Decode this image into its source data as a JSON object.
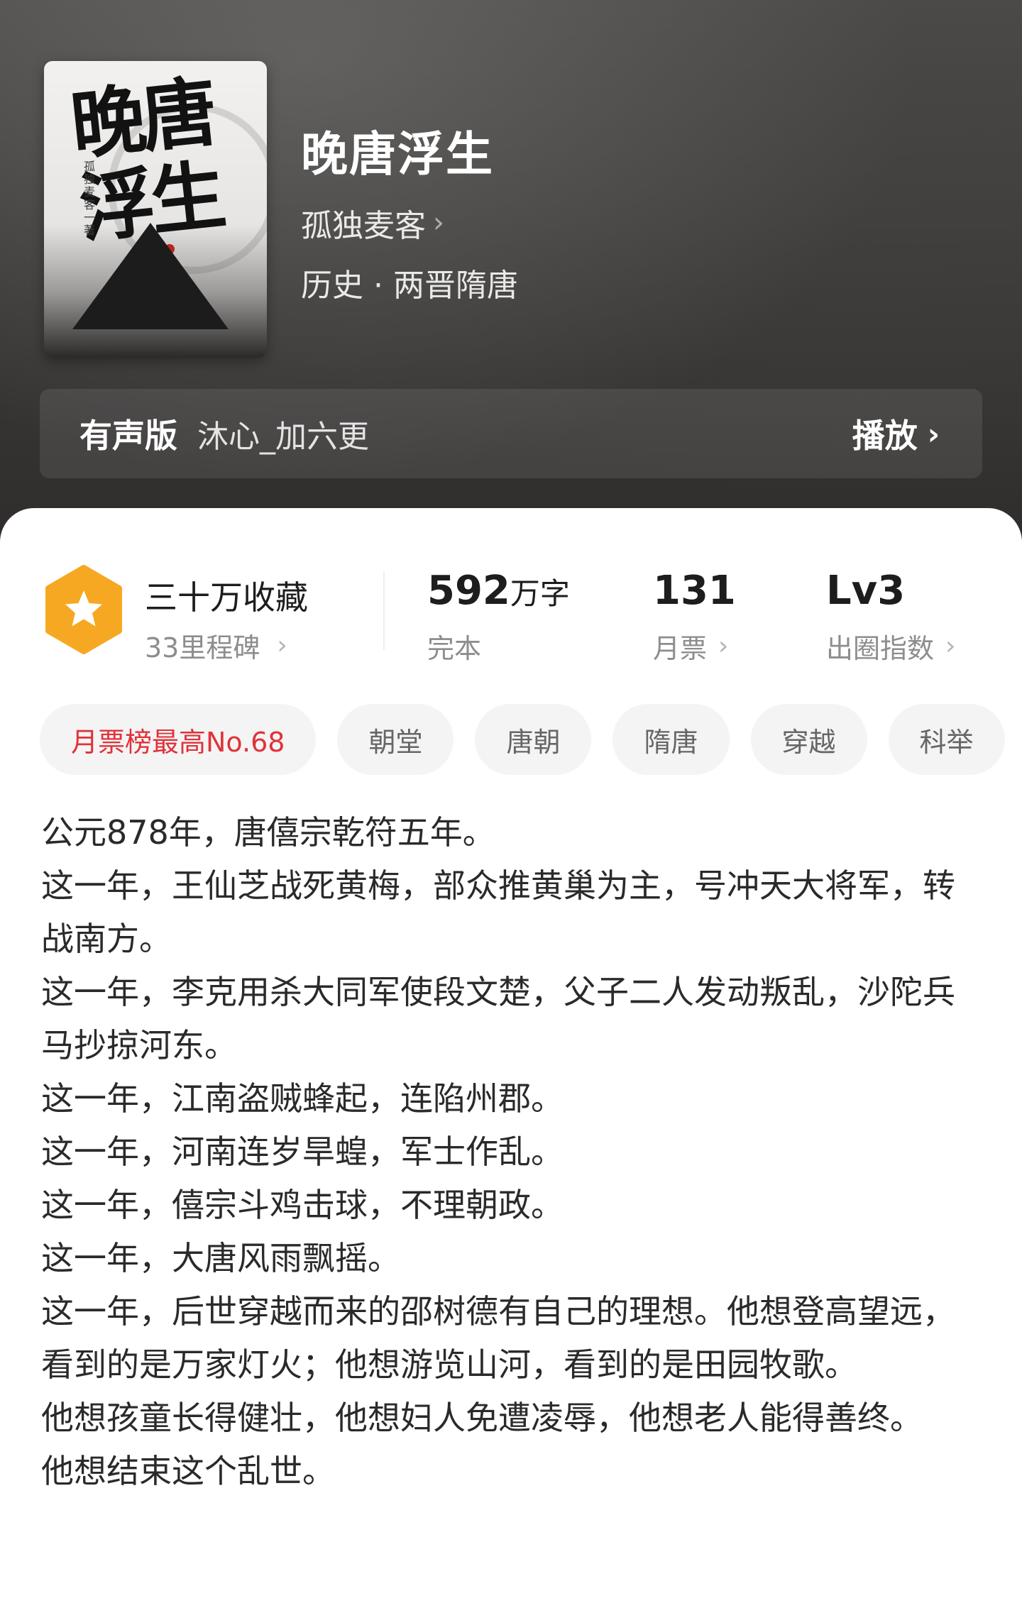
{
  "book": {
    "cover_title": "晚唐浮生",
    "cover_author": "孤独麦客一著",
    "title": "晚唐浮生",
    "author": "孤独麦客",
    "category": "历史 · 两晋隋唐"
  },
  "audio": {
    "label": "有声版",
    "narrator": "沐心_加六更",
    "play_label": "播放"
  },
  "stats": {
    "favorites": {
      "title": "三十万收藏",
      "milestone": "33里程碑"
    },
    "words": {
      "value": "592",
      "unit": "万字",
      "label": "完本"
    },
    "monthly_votes": {
      "value": "131",
      "label": "月票"
    },
    "breakout": {
      "value": "Lv3",
      "label": "出圈指数"
    }
  },
  "tags": [
    "月票榜最高No.68",
    "朝堂",
    "唐朝",
    "隋唐",
    "穿越",
    "科举"
  ],
  "synopsis": [
    "公元878年，唐僖宗乾符五年。",
    "这一年，王仙芝战死黄梅，部众推黄巢为主，号冲天大将军，转战南方。",
    "这一年，李克用杀大同军使段文楚，父子二人发动叛乱，沙陀兵马抄掠河东。",
    "这一年，江南盗贼蜂起，连陷州郡。",
    "这一年，河南连岁旱蝗，军士作乱。",
    "这一年，僖宗斗鸡击球，不理朝政。",
    "这一年，大唐风雨飘摇。",
    "这一年，后世穿越而来的邵树德有自己的理想。他想登高望远，看到的是万家灯火；他想游览山河，看到的是田园牧歌。",
    "他想孩童长得健壮，他想妇人免遭凌辱，他想老人能得善终。",
    "他想结束这个乱世。"
  ],
  "colors": {
    "accent_red": "#e0323a",
    "badge_orange": "#f7a823",
    "header_dark": "#3d3b3a"
  }
}
